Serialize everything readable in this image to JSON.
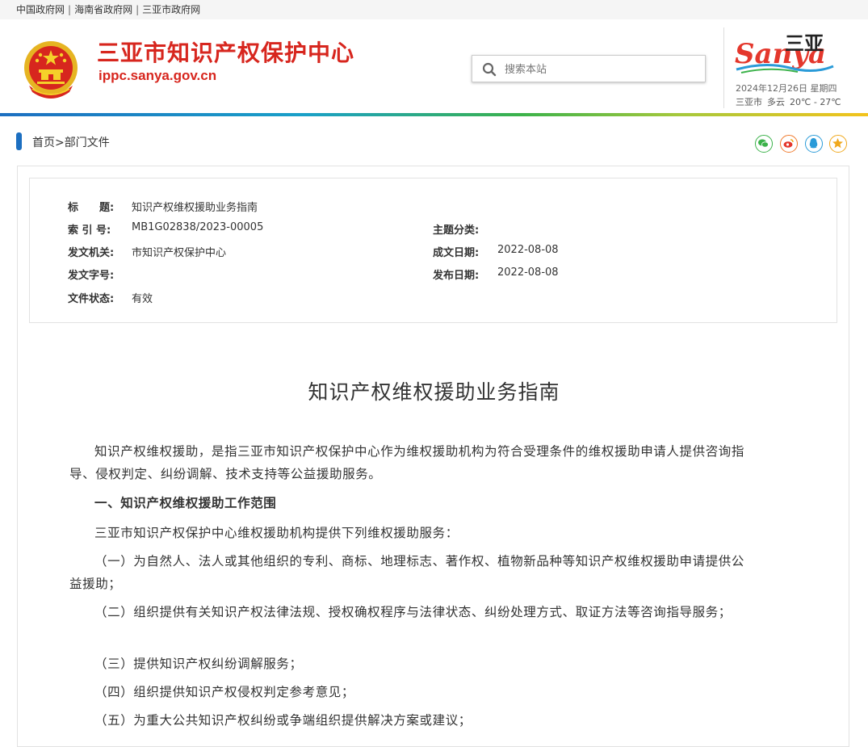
{
  "top_links": [
    "中国政府网",
    "海南省政府网",
    "三亚市政府网"
  ],
  "header": {
    "site_title": "三亚市知识产权保护中心",
    "site_domain": "ippc.sanya.gov.cn",
    "search_placeholder": "搜索本站",
    "logo_text": "Sanya",
    "logo_cn": "三亚",
    "date": "2024年12月26日",
    "weekday": "星期四",
    "city": "三亚市",
    "weather": "多云",
    "temperature": "20℃ - 27℃"
  },
  "breadcrumb": {
    "home": "首页",
    "separator": ">",
    "current": "部门文件"
  },
  "share_icons": [
    "wechat-icon",
    "weibo-icon",
    "qq-icon",
    "favorite-icon"
  ],
  "colors": {
    "brand_red": "#d7261e",
    "accent_blue": "#1c6fc1",
    "share_green": "#3bb24a",
    "share_orange": "#f07a2c",
    "share_blue": "#2a9bd8",
    "share_gold": "#f0a81c"
  },
  "meta": {
    "title_label": "标　　题:",
    "title_value": "知识产权维权援助业务指南",
    "index_label": "索 引 号:",
    "index_value": "MB1G02838/2023-00005",
    "category_label": "主题分类:",
    "category_value": "",
    "issuer_label": "发文机关:",
    "issuer_value": "市知识产权保护中心",
    "created_label": "成文日期:",
    "created_value": "2022-08-08",
    "docnum_label": "发文字号:",
    "docnum_value": "",
    "published_label": "发布日期:",
    "published_value": "2022-08-08",
    "status_label": "文件状态:",
    "status_value": "有效"
  },
  "article": {
    "title": "知识产权维权援助业务指南",
    "paragraphs": [
      "知识产权维权援助，是指三亚市知识产权保护中心作为维权援助机构为符合受理条件的维权援助申请人提供咨询指导、侵权判定、纠纷调解、技术支持等公益援助服务。",
      "一、知识产权维权援助工作范围",
      "三亚市知识产权保护中心维权援助机构提供下列维权援助服务：",
      "（一）为自然人、法人或其他组织的专利、商标、地理标志、著作权、植物新品种等知识产权维权援助申请提供公益援助；",
      "（二）组织提供有关知识产权法律法规、授权确权程序与法律状态、纠纷处理方式、取证方法等咨询指导服务；",
      "（三）提供知识产权纠纷调解服务；",
      "（四）组织提供知识产权侵权判定参考意见；",
      "（五）为重大公共知识产权纠纷或争端组织提供解决方案或建议；"
    ]
  }
}
